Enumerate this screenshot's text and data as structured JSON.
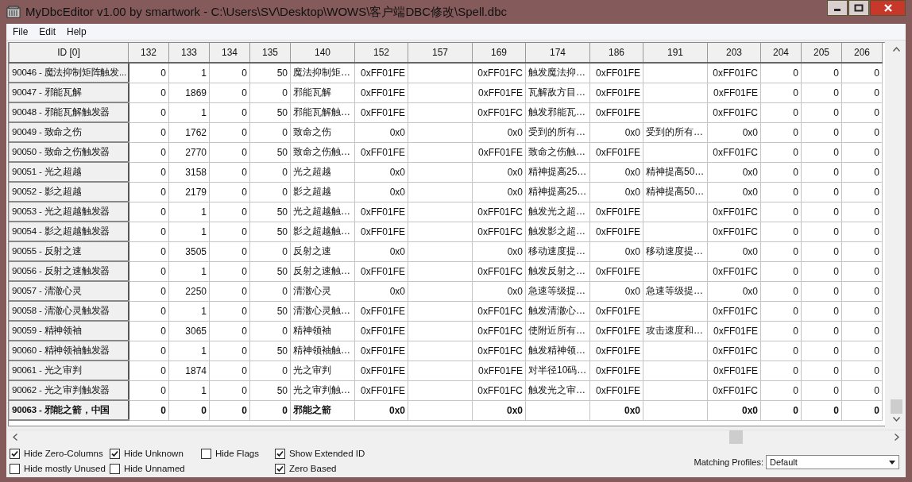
{
  "window": {
    "title": "MyDbcEditor v1.00 by smartwork - C:\\Users\\SV\\Desktop\\WOWS\\客户端DBC修改\\Spell.dbc"
  },
  "menu": [
    "File",
    "Edit",
    "Help"
  ],
  "table": {
    "columns": [
      {
        "label": "ID [0]",
        "kind": "id"
      },
      {
        "label": "132",
        "kind": "num"
      },
      {
        "label": "133",
        "kind": "num"
      },
      {
        "label": "134",
        "kind": "num"
      },
      {
        "label": "135",
        "kind": "num"
      },
      {
        "label": "140",
        "kind": "text"
      },
      {
        "label": "152",
        "kind": "hex"
      },
      {
        "label": "157",
        "kind": "text"
      },
      {
        "label": "169",
        "kind": "hex"
      },
      {
        "label": "174",
        "kind": "text"
      },
      {
        "label": "186",
        "kind": "hex"
      },
      {
        "label": "191",
        "kind": "text"
      },
      {
        "label": "203",
        "kind": "hex"
      },
      {
        "label": "204",
        "kind": "num"
      },
      {
        "label": "205",
        "kind": "num"
      },
      {
        "label": "206",
        "kind": "num"
      }
    ],
    "rows": [
      {
        "selected": false,
        "cells": [
          "90046 - 魔法抑制矩阵触发...",
          "0",
          "1",
          "0",
          "50",
          "魔法抑制矩…",
          "0xFF01FE",
          null,
          "0xFF01FC",
          "触发魔法抑…",
          "0xFF01FE",
          null,
          "0xFF01FC",
          "0",
          "0",
          "0"
        ]
      },
      {
        "selected": false,
        "cells": [
          "90047 - 邪能瓦解",
          "0",
          "1869",
          "0",
          "0",
          "邪能瓦解",
          "0xFF01FE",
          null,
          "0xFF01FE",
          "瓦解敌方目…",
          "0xFF01FE",
          null,
          "0xFF01FE",
          "0",
          "0",
          "0"
        ]
      },
      {
        "selected": false,
        "cells": [
          "90048 - 邪能瓦解触发器",
          "0",
          "1",
          "0",
          "50",
          "邪能瓦解触…",
          "0xFF01FE",
          null,
          "0xFF01FC",
          "触发邪能瓦…",
          "0xFF01FE",
          null,
          "0xFF01FC",
          "0",
          "0",
          "0"
        ]
      },
      {
        "selected": false,
        "cells": [
          "90049 - 致命之伤",
          "0",
          "1762",
          "0",
          "0",
          "致命之伤",
          "0x0",
          null,
          "0x0",
          "受到的所有…",
          "0x0",
          "受到的所有…",
          "0x0",
          "0",
          "0",
          "0"
        ]
      },
      {
        "selected": false,
        "cells": [
          "90050 - 致命之伤触发器",
          "0",
          "2770",
          "0",
          "50",
          "致命之伤触…",
          "0xFF01FE",
          null,
          "0xFF01FE",
          "致命之伤触…",
          "0xFF01FE",
          null,
          "0xFF01FC",
          "0",
          "0",
          "0"
        ]
      },
      {
        "selected": false,
        "cells": [
          "90051 - 光之超越",
          "0",
          "3158",
          "0",
          "0",
          "光之超越",
          "0x0",
          null,
          "0x0",
          "精神提高25…",
          "0x0",
          "精神提高50…",
          "0x0",
          "0",
          "0",
          "0"
        ]
      },
      {
        "selected": false,
        "cells": [
          "90052 - 影之超越",
          "0",
          "2179",
          "0",
          "0",
          "影之超越",
          "0x0",
          null,
          "0x0",
          "精神提高25…",
          "0x0",
          "精神提高50…",
          "0x0",
          "0",
          "0",
          "0"
        ]
      },
      {
        "selected": false,
        "cells": [
          "90053 - 光之超越触发器",
          "0",
          "1",
          "0",
          "50",
          "光之超越触…",
          "0xFF01FE",
          null,
          "0xFF01FC",
          "触发光之超…",
          "0xFF01FE",
          null,
          "0xFF01FC",
          "0",
          "0",
          "0"
        ]
      },
      {
        "selected": false,
        "cells": [
          "90054 - 影之超越触发器",
          "0",
          "1",
          "0",
          "50",
          "影之超越触…",
          "0xFF01FE",
          null,
          "0xFF01FC",
          "触发影之超…",
          "0xFF01FE",
          null,
          "0xFF01FC",
          "0",
          "0",
          "0"
        ]
      },
      {
        "selected": false,
        "cells": [
          "90055 - 反射之速",
          "0",
          "3505",
          "0",
          "0",
          "反射之速",
          "0x0",
          null,
          "0x0",
          "移动速度提…",
          "0x0",
          "移动速度提…",
          "0x0",
          "0",
          "0",
          "0"
        ]
      },
      {
        "selected": false,
        "cells": [
          "90056 - 反射之速触发器",
          "0",
          "1",
          "0",
          "50",
          "反射之速触…",
          "0xFF01FE",
          null,
          "0xFF01FC",
          "触发反射之…",
          "0xFF01FE",
          null,
          "0xFF01FC",
          "0",
          "0",
          "0"
        ]
      },
      {
        "selected": false,
        "cells": [
          "90057 - 清澈心灵",
          "0",
          "2250",
          "0",
          "0",
          "清澈心灵",
          "0x0",
          null,
          "0x0",
          "急速等级提…",
          "0x0",
          "急速等级提…",
          "0x0",
          "0",
          "0",
          "0"
        ]
      },
      {
        "selected": false,
        "cells": [
          "90058 - 清澈心灵触发器",
          "0",
          "1",
          "0",
          "50",
          "清澈心灵触…",
          "0xFF01FE",
          null,
          "0xFF01FC",
          "触发清澈心…",
          "0xFF01FE",
          null,
          "0xFF01FC",
          "0",
          "0",
          "0"
        ]
      },
      {
        "selected": false,
        "cells": [
          "90059 - 精神领袖",
          "0",
          "3065",
          "0",
          "0",
          "精神领袖",
          "0xFF01FE",
          null,
          "0xFF01FC",
          "使附近所有…",
          "0xFF01FE",
          "攻击速度和…",
          "0xFF01FE",
          "0",
          "0",
          "0"
        ]
      },
      {
        "selected": false,
        "cells": [
          "90060 - 精神领袖触发器",
          "0",
          "1",
          "0",
          "50",
          "精神领袖触…",
          "0xFF01FE",
          null,
          "0xFF01FC",
          "触发精神领…",
          "0xFF01FE",
          null,
          "0xFF01FC",
          "0",
          "0",
          "0"
        ]
      },
      {
        "selected": false,
        "cells": [
          "90061 - 光之审判",
          "0",
          "1874",
          "0",
          "0",
          "光之审判",
          "0xFF01FE",
          null,
          "0xFF01FE",
          "对半径10码…",
          "0xFF01FE",
          null,
          "0xFF01FE",
          "0",
          "0",
          "0"
        ]
      },
      {
        "selected": false,
        "cells": [
          "90062 - 光之审判触发器",
          "0",
          "1",
          "0",
          "50",
          "光之审判触…",
          "0xFF01FE",
          null,
          "0xFF01FC",
          "触发光之审…",
          "0xFF01FE",
          null,
          "0xFF01FC",
          "0",
          "0",
          "0"
        ]
      },
      {
        "selected": true,
        "cells": [
          "90063 - 邪能之箭，中国",
          "0",
          "0",
          "0",
          "0",
          "邪能之箭",
          "0x0",
          null,
          "0x0",
          null,
          "0x0",
          null,
          "0x0",
          "0",
          "0",
          "0"
        ]
      }
    ]
  },
  "options": [
    [
      {
        "label": "Hide Zero-Columns",
        "checked": true
      },
      {
        "label": "Hide mostly Unused",
        "checked": false
      }
    ],
    [
      {
        "label": "Hide Unknown",
        "checked": true
      },
      {
        "label": "Hide Unnamed",
        "checked": false
      }
    ],
    [
      {
        "label": "Hide Flags",
        "checked": false
      }
    ],
    [
      {
        "label": "Show Extended ID",
        "checked": true
      },
      {
        "label": "Zero Based",
        "checked": true
      }
    ]
  ],
  "profiles": {
    "label": "Matching Profiles:",
    "value": "Default"
  }
}
